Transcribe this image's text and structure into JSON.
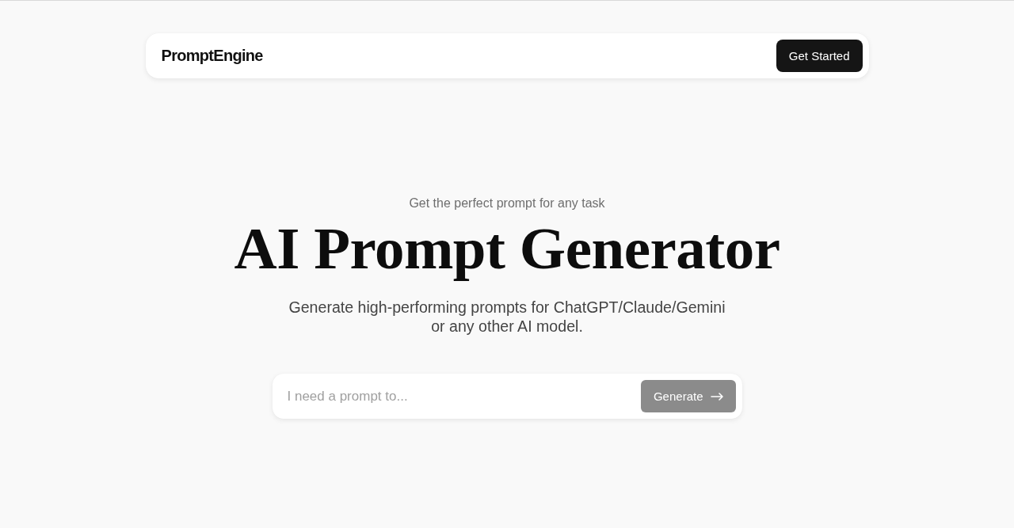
{
  "nav": {
    "logo": "PromptEngine",
    "cta_button": "Get Started"
  },
  "hero": {
    "eyebrow": "Get the perfect prompt for any task",
    "title": "AI Prompt Generator",
    "description": "Generate high-performing prompts for ChatGPT/Claude/Gemini or any other AI model."
  },
  "prompt_form": {
    "placeholder": "I need a prompt to...",
    "submit_button": {
      "label": "Generate",
      "disabled": true
    }
  }
}
